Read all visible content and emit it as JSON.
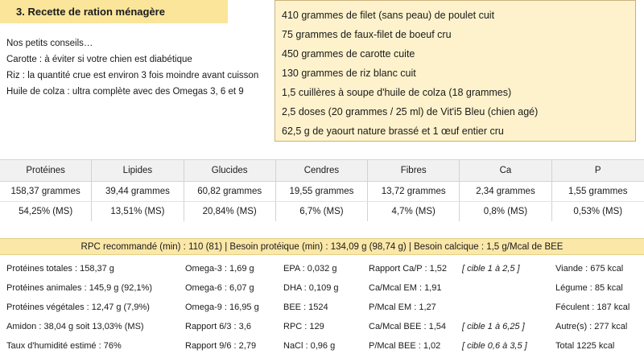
{
  "section": {
    "title": "3. Recette de ration ménagère"
  },
  "tips": {
    "intro": "Nos petits conseils…",
    "items": [
      "Carotte : à éviter si votre chien est diabétique",
      "Riz : la quantité crue est environ 3 fois moindre avant cuisson",
      "Huile de colza : ultra complète avec des Omegas 3, 6 et 9"
    ]
  },
  "recipe": {
    "items": [
      "410 grammes de filet (sans peau) de poulet cuit",
      "75 grammes de faux-filet de boeuf cru",
      "450 grammes de carotte cuite",
      "130 grammes de riz blanc cuit",
      "1,5 cuillères à soupe d'huile de colza (18 grammes)",
      "2,5 doses (20 grammes / 25 ml) de Vit'i5 Bleu (chien agé)",
      "62,5 g de yaourt nature brassé et 1 œuf entier cru"
    ]
  },
  "nutrients": {
    "headers": [
      "Protéines",
      "Lipides",
      "Glucides",
      "Cendres",
      "Fibres",
      "Ca",
      "P"
    ],
    "grams": [
      "158,37 grammes",
      "39,44 grammes",
      "60,82 grammes",
      "19,55 grammes",
      "13,72 grammes",
      "2,34 grammes",
      "1,55 grammes"
    ],
    "percent": [
      "54,25% (MS)",
      "13,51% (MS)",
      "20,84% (MS)",
      "6,7% (MS)",
      "4,7% (MS)",
      "0,8% (MS)",
      "0,53% (MS)"
    ]
  },
  "summary": {
    "text": "RPC recommandé (min) : 110 (81)   |   Besoin protéique (min) : 134,09 g (98,74 g)   |   Besoin calcique : 1,5 g/Mcal de BEE"
  },
  "stats": {
    "rows": [
      [
        "Protéines totales : 158,37 g",
        "Omega-3 : 1,69 g",
        "EPA : 0,032 g",
        "Rapport Ca/P : 1,52",
        "[ cible 1 à 2,5 ]",
        "Viande : 675 kcal"
      ],
      [
        "Protéines animales : 145,9 g (92,1%)",
        "Omega-6 : 6,07 g",
        "DHA : 0,109 g",
        "Ca/Mcal EM : 1,91",
        "",
        "Légume : 85 kcal"
      ],
      [
        "Protéines végétales : 12,47 g (7,9%)",
        "Omega-9 : 16,95 g",
        "BEE : 1524",
        "P/Mcal EM : 1,27",
        "",
        "Féculent : 187 kcal"
      ],
      [
        "Amidon : 38,04 g soit 13,03% (MS)",
        "Rapport 6/3 : 3,6",
        "RPC : 129",
        "Ca/Mcal BEE : 1,54",
        "[ cible 1 à 6,25 ]",
        "Autre(s) : 277 kcal"
      ],
      [
        "Taux d'humidité estimé : 76%",
        "Rapport 9/6 : 2,79",
        "NaCl : 0,96 g",
        "P/Mcal BEE : 1,02",
        "[ cible 0,6 à 3,5 ]",
        "Total   1225 kcal"
      ]
    ]
  }
}
